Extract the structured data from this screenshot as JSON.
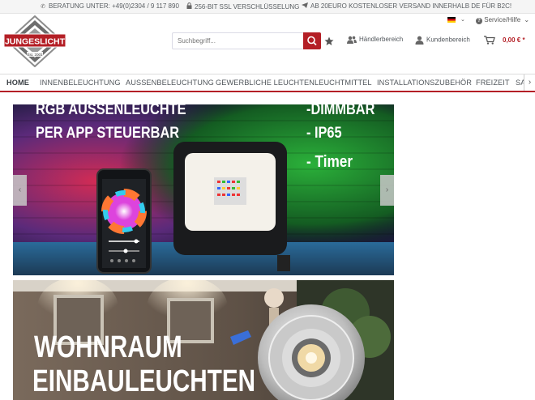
{
  "topbar": {
    "hotline": "BERATUNG UNTER: +49(0)2304 / 9 117 890",
    "ssl": "256-BIT SSL VERSCHLÜSSELUNG",
    "shipping": "AB 20EURO KOSTENLOSER VERSAND INNERHALB DE FÜR B2C!"
  },
  "header": {
    "logo_text": "JUNGESLICHT",
    "logo_est": "Est. 2001",
    "search_placeholder": "Suchbegriff...",
    "dealer_link": "Händlerbereich",
    "customer_link": "Kundenbereich",
    "cart_total": "0,00 € *",
    "service_link": "Service/Hilfe"
  },
  "nav": {
    "items": [
      {
        "label": "HOME"
      },
      {
        "label": "INNENBELEUCHTUNG"
      },
      {
        "label": "AUSSENBELEUCHTUNG"
      },
      {
        "label": "GEWERBLICHE LEUCHTEN"
      },
      {
        "label": "LEUCHTMITTEL"
      },
      {
        "label": "INSTALLATIONSZUBEHÖR"
      },
      {
        "label": "FREIZEIT"
      },
      {
        "label": "SA"
      }
    ]
  },
  "banners": {
    "slide1": {
      "title1": "RGB AUSSENLEUCHTE",
      "title2": "PER APP STEUERBAR",
      "bullet1": "-DIMMBAR",
      "bullet2": "- IP65",
      "bullet3": "- Timer"
    },
    "slide2": {
      "title1": "WOHNRAUM",
      "title2": "EINBAULEUCHTEN"
    }
  },
  "colors": {
    "brand_red": "#b41f26",
    "text": "#52575c"
  }
}
